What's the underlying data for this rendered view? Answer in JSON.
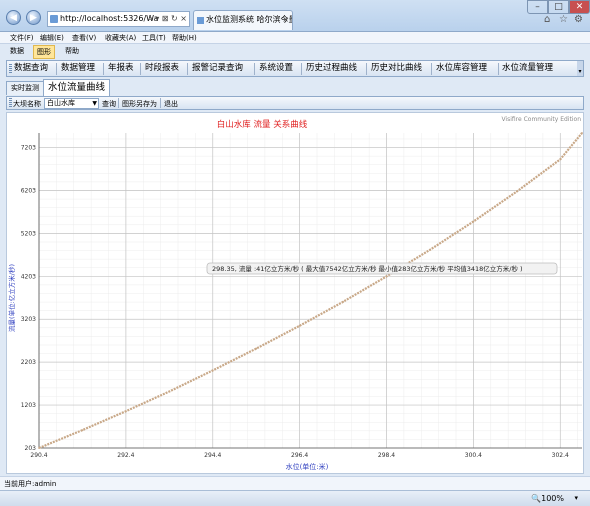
{
  "browser": {
    "address": "http://localhost:5326/Wa",
    "address_controls": "⌕ ▾ ⊠ ↻ ×",
    "tab_title": "水位监测系统 哈尔滨今量...",
    "tab_close": "×",
    "back": "◀",
    "forward": "▶",
    "minimize": "–",
    "maximize": "□",
    "close": "✕",
    "home_icon": "⌂",
    "favorites_icon": "☆",
    "tools_icon": "⚙",
    "menu": [
      "文件(F)",
      "编辑(E)",
      "查看(V)",
      "收藏夹(A)",
      "工具(T)",
      "帮助(H)"
    ],
    "zoom": "🔍100%",
    "zoom_arrow": "▾"
  },
  "app": {
    "menu": [
      "数据",
      "图形",
      "帮助"
    ],
    "nav": [
      "数据查询",
      "数据管理",
      "年报表",
      "时段报表",
      "报警记录查询",
      "系统设置",
      "历史过程曲线",
      "历史对比曲线",
      "水位库容管理",
      "水位流量管理"
    ],
    "tabs": [
      "实时监测",
      "水位流量曲线"
    ],
    "toolbar": {
      "label": "大坝名称",
      "combo_value": "白山水库",
      "query": "查询",
      "save_as": "图形另存为",
      "exit": "退出"
    },
    "status": "当前用户:admin"
  },
  "chart_data": {
    "type": "line",
    "title": "白山水库 流量 关系曲线",
    "watermark": "Visifire Community Edition",
    "xlabel": "水位(单位:米)",
    "ylabel": "流量(单位:亿立方米/秒)",
    "xlim": [
      290.4,
      302.9
    ],
    "ylim": [
      203,
      7542
    ],
    "xticks": [
      "290.4",
      "292.4",
      "294.4",
      "296.4",
      "298.4",
      "300.4",
      "302.4"
    ],
    "yticks": [
      "203",
      "1203",
      "2203",
      "3203",
      "4203",
      "5203",
      "6203",
      "7203"
    ],
    "grid": true,
    "series": [
      {
        "color": "#c8a888",
        "x": [
          290.4,
          291.4,
          292.4,
          293.4,
          294.4,
          295.4,
          296.4,
          297.4,
          298.4,
          299.4,
          300.4,
          301.4,
          302.4,
          302.9
        ],
        "values": [
          203,
          620,
          1060,
          1520,
          2010,
          2520,
          3050,
          3610,
          4200,
          4820,
          5480,
          6180,
          6930,
          7542
        ]
      }
    ],
    "tooltip": "298.35, 流量 :41亿立方米/秒 (  最大值7542亿立方米/秒   最小值283亿立方米/秒   平均值3418亿立方米/秒 )"
  }
}
